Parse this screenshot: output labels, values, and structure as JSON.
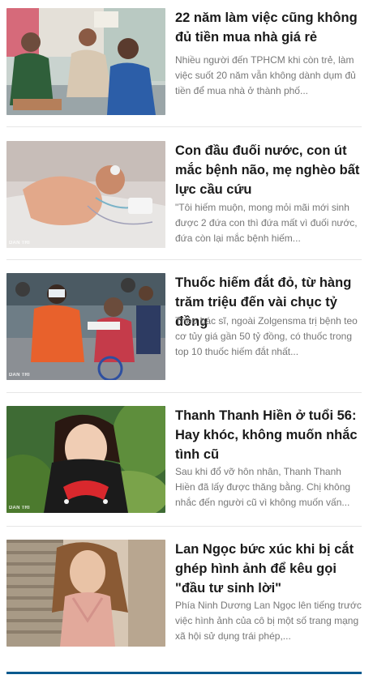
{
  "brand": {
    "watermark": "DAN TRI",
    "accent_color": "#0a5a8f"
  },
  "articles": [
    {
      "title": "22 năm làm việc cũng không đủ tiền mua nhà giá rẻ",
      "summary": "Nhiều người đến TPHCM khi còn trẻ, làm việc suốt 20 năm vẫn không dành dụm đủ tiền để mua nhà ở thành phố..."
    },
    {
      "title": "Con đầu đuối nước, con út mắc bệnh não, mẹ nghèo bất lực cầu cứu",
      "summary": "\"Tôi hiếm muộn, mong mỏi mãi mới sinh được 2 đứa con thì đứa mất vì đuối nước, đứa còn lại mắc bệnh hiếm..."
    },
    {
      "title": "Thuốc hiếm đắt đỏ, từ hàng trăm triệu đến vài chục tỷ đồng",
      "summary": "Theo bác sĩ, ngoài Zolgensma trị bệnh teo cơ tủy giá gần 50 tỷ đồng, có thuốc trong top 10 thuốc hiếm đắt nhất..."
    },
    {
      "title": "Thanh Thanh Hiền ở tuổi 56: Hay khóc, không muốn nhắc tình cũ",
      "summary": "Sau khi đổ vỡ hôn nhân, Thanh Thanh Hiền đã lấy được thăng bằng. Chị không nhắc đến người cũ vì không muốn vấn..."
    },
    {
      "title": "Lan Ngọc bức xúc khi bị cắt ghép hình ảnh để kêu gọi \"đầu tư sinh lời\"",
      "summary": "Phía Ninh Dương Lan Ngọc lên tiếng trước việc hình ảnh của cô bị một số trang mạng xã hội sử dụng trái phép,..."
    }
  ]
}
